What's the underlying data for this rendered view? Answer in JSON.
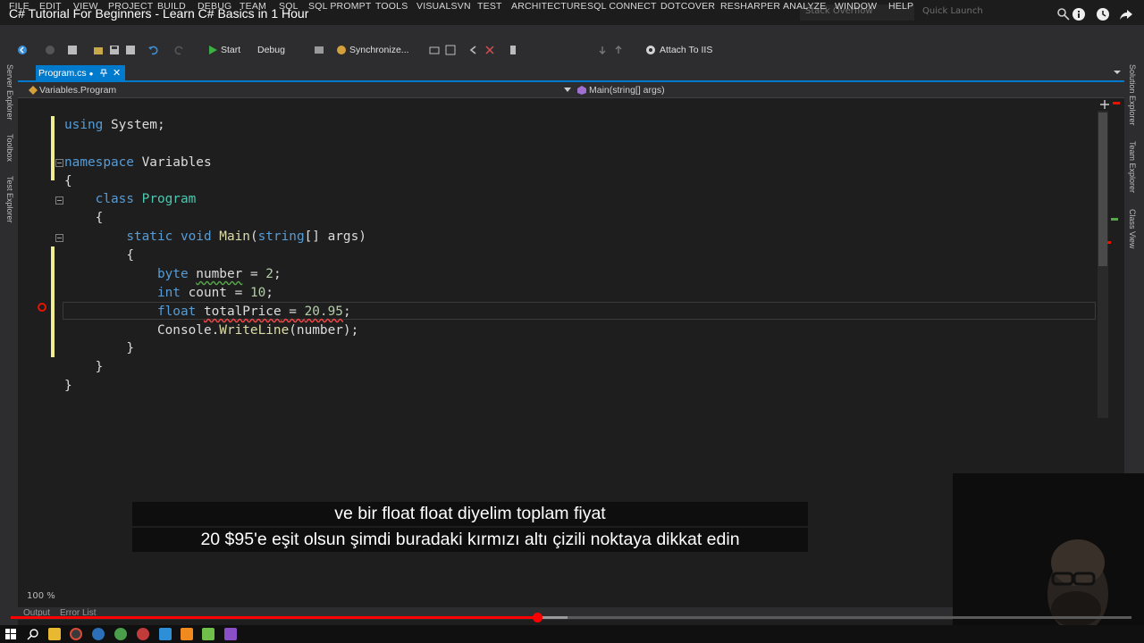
{
  "window": {
    "title": "C# Tutorial For Beginners - Learn C# Basics in 1 Hour",
    "search_placeholder": "Stack Overflow",
    "quick_launch": "Quick Launch"
  },
  "menu": [
    "FILE",
    "EDIT",
    "VIEW",
    "PROJECT",
    "BUILD",
    "DEBUG",
    "TEAM",
    "SQL",
    "SQL PROMPT",
    "TOOLS",
    "VISUALSVN",
    "TEST",
    "ARCHITECTURE",
    "SQL CONNECT",
    "DOTCOVER",
    "RESHARPER",
    "ANALYZE",
    "WINDOW",
    "HELP"
  ],
  "toolbar": {
    "start_label": "Start",
    "config_label": "Debug",
    "sync_label": "Synchronize...",
    "attach_label": "Attach To IIS"
  },
  "left_tools": [
    "Server Explorer",
    "Toolbox",
    "Test Explorer"
  ],
  "right_tools": [
    "Solution Explorer",
    "Team Explorer",
    "Class View"
  ],
  "tab": {
    "label": "Program.cs",
    "modified_mark": "●",
    "close": "✕"
  },
  "nav": {
    "class_path": "Variables.Program",
    "member_path": "Main(string[] args)"
  },
  "code": {
    "line1_kw": "using",
    "line1_rest": " System;",
    "line3_kw": "namespace",
    "line3_rest": " Variables",
    "open_brace": "{",
    "close_brace": "}",
    "line5_kw": "class",
    "line5_type": "Program",
    "line7_static": "static",
    "line7_void": "void",
    "line7_fn": "Main",
    "line7_paren": "(",
    "line7_string": "string",
    "line7_args": "[] args)",
    "line9_kw": "byte",
    "line9_var": "number",
    "line9_rest": " = ",
    "line9_num": "2",
    "line10_kw": "int",
    "line10_rest": " count = ",
    "line10_num": "10",
    "line11_kw": "float",
    "line11_var": "totalPrice",
    "line11_rest": " = ",
    "line11_num": "20.95",
    "line12_obj": "Console.",
    "line12_fn": "WriteLine",
    "line12_rest": "(number);",
    "semicolon": ";"
  },
  "subtitle": {
    "line1": "ve bir float float diyelim toplam fiyat",
    "line2": "20 $95'e eşit olsun şimdi buradaki kırmızı altı çizili noktaya dikkat edin"
  },
  "status": {
    "zoom": "100 %",
    "bottom_tabs": [
      "Output",
      "Error List"
    ]
  },
  "video_progress": 0.47,
  "colors": {
    "accent": "#007acc",
    "keyword": "#569cd6",
    "type": "#4ec9b0",
    "method": "#dcdcaa",
    "number": "#b5cea8",
    "progress": "#ff0000"
  },
  "taskbar_icons": [
    "windows-icon",
    "search-icon",
    "file-explorer-icon",
    "chrome-icon",
    "chrome-icon",
    "steam-icon",
    "opera-icon",
    "visual-studio-code-icon",
    "vlc-icon",
    "notepad-icon",
    "visual-studio-icon"
  ]
}
